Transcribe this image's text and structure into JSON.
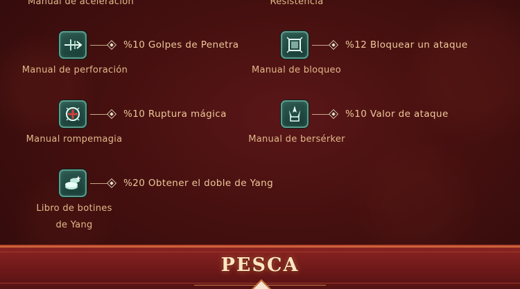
{
  "top_labels": {
    "left": "Manual de aceleración",
    "right": "Resistencia"
  },
  "skills": [
    {
      "name": "Manual de perforación",
      "bonus": "%10 Golpes de Penetra",
      "icon": "piercing-arrows-icon"
    },
    {
      "name": "Manual de bloqueo",
      "bonus": "%12 Bloquear un ataque",
      "icon": "block-shield-icon"
    },
    {
      "name": "Manual rompemagia",
      "bonus": "%10 Ruptura mágica",
      "icon": "magic-break-icon"
    },
    {
      "name": "Manual de bersérker",
      "bonus": "%10 Valor de ataque",
      "icon": "berserker-spikes-icon"
    },
    {
      "name_line1": "Libro de botines",
      "name_line2": "de Yang",
      "bonus": "%20 Obtener el doble de Yang",
      "icon": "yang-coins-icon"
    }
  ],
  "footer": {
    "title": "PESCA"
  },
  "colors": {
    "background": "#3a0e10",
    "label": "#e3b98a",
    "bonus": "#efc89a",
    "icon_frame": "#5b9c8c",
    "footer_band": "#8a2422"
  }
}
